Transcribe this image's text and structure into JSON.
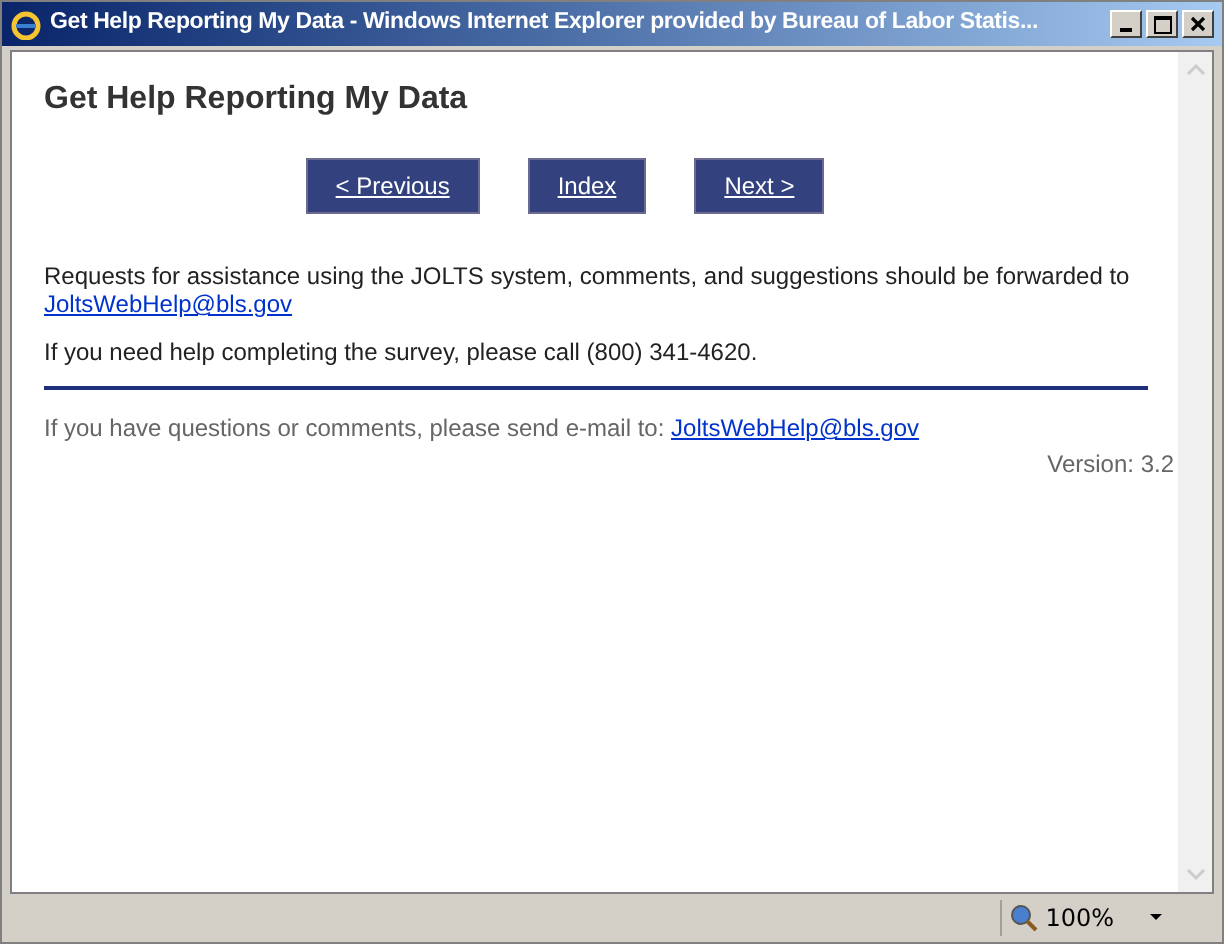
{
  "window": {
    "title": "Get Help Reporting My Data - Windows Internet Explorer provided by Bureau of Labor Statis..."
  },
  "page": {
    "heading": "Get Help Reporting My Data",
    "nav_buttons": [
      "< Previous",
      "Index",
      "Next >"
    ],
    "request_text": "Requests for assistance using the JOLTS system, comments, and suggestions should be forwarded to",
    "request_link": "JoltsWebHelp@bls.gov",
    "phone_text": "If you need help completing the survey, please call (800) 341-4620.",
    "footer_text": "If you have questions or comments, please send e-mail to:",
    "footer_link": "JoltsWebHelp@bls.gov",
    "version": "Version: 3.2"
  },
  "status_bar": {
    "zoom": "100%"
  }
}
